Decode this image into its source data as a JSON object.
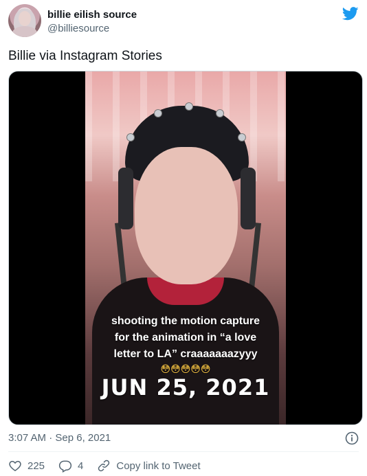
{
  "tweet": {
    "author": {
      "display_name": "billie eilish source",
      "handle": "@billiesource"
    },
    "text": "Billie via Instagram Stories",
    "media": {
      "caption_lines": [
        "shooting the motion capture",
        "for the animation in “a love",
        "letter to LA” craaaaaaazyyy"
      ],
      "emojis": "😳😳😳😳😳",
      "date_stamp": "JUN 25, 2021"
    },
    "timestamp": "3:07 AM · Sep 6, 2021",
    "actions": {
      "likes": "225",
      "replies": "4",
      "copy_link_label": "Copy link to Tweet"
    }
  },
  "colors": {
    "twitter_blue": "#1d9bf0",
    "secondary_text": "#536471",
    "primary_text": "#0f1419"
  },
  "icons": {
    "brand": "twitter-bird-icon",
    "info": "info-icon",
    "like": "heart-icon",
    "reply": "reply-icon",
    "link": "link-icon"
  }
}
